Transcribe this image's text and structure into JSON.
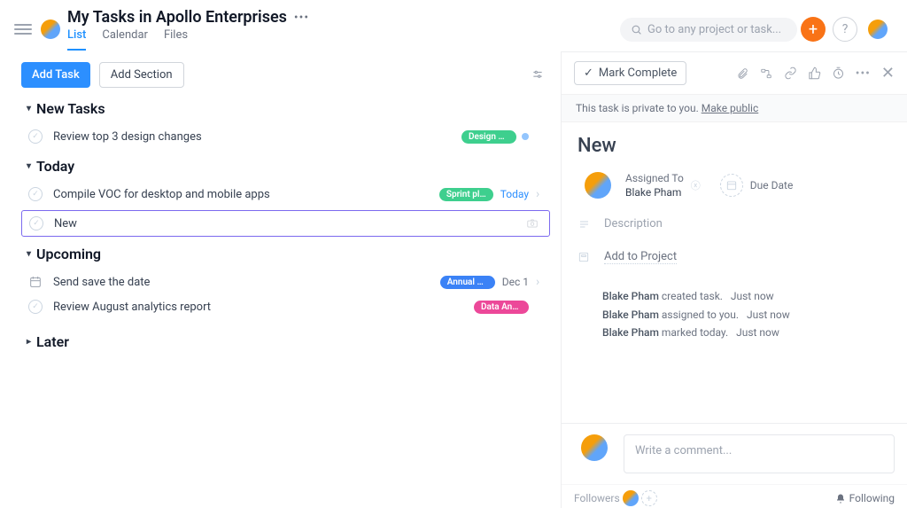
{
  "header": {
    "title": "My Tasks in Apollo Enterprises",
    "tabs": {
      "list": "List",
      "calendar": "Calendar",
      "files": "Files"
    },
    "search_placeholder": "Go to any project or task..."
  },
  "toolbar": {
    "add_task": "Add Task",
    "add_section": "Add Section"
  },
  "sections": {
    "new_tasks": "New Tasks",
    "today": "Today",
    "upcoming": "Upcoming",
    "later": "Later"
  },
  "tasks": {
    "t1": {
      "name": "Review top 3 design changes",
      "pill": "Design w…"
    },
    "t2": {
      "name": "Compile VOC for desktop and mobile apps",
      "pill": "Sprint pl…",
      "due": "Today"
    },
    "editing": {
      "value": "New"
    },
    "t3": {
      "name": "Send save the date",
      "pill": "Annual c…",
      "due": "Dec 1"
    },
    "t4": {
      "name": "Review August analytics report",
      "pill": "Data Ana…"
    }
  },
  "detail": {
    "mark_complete": "Mark Complete",
    "privacy_text": "This task is private to you. ",
    "make_public": "Make public",
    "title": "New",
    "assigned_label": "Assigned To",
    "assigned_name": "Blake Pham",
    "due_label": "Due Date",
    "description": "Description",
    "add_project": "Add to Project",
    "activity": {
      "a1_name": "Blake Pham",
      "a1_text": " created task.",
      "a1_time": "Just now",
      "a2_name": "Blake Pham",
      "a2_text": " assigned to you.",
      "a2_time": "Just now",
      "a3_name": "Blake Pham",
      "a3_text": " marked today.",
      "a3_time": "Just now"
    },
    "comment_placeholder": "Write a comment...",
    "followers": "Followers",
    "following": "Following"
  }
}
